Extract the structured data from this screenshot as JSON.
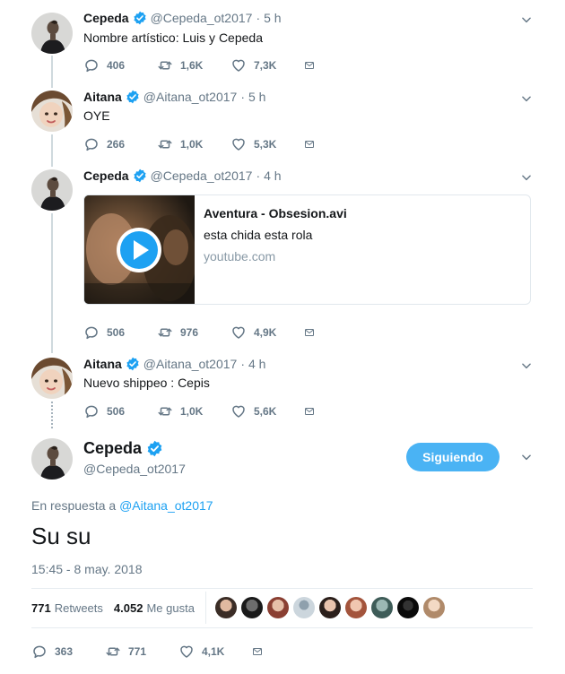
{
  "colors": {
    "accent": "#1da1f2",
    "muted": "#657786",
    "follow_bg": "#4ab3f4"
  },
  "tweets": [
    {
      "name": "Cepeda",
      "handle": "@Cepeda_ot2017",
      "time": "5 h",
      "text": "Nombre artístico: Luis y Cepeda",
      "replies": "406",
      "retweets": "1,6K",
      "likes": "7,3K"
    },
    {
      "name": "Aitana",
      "handle": "@Aitana_ot2017",
      "time": "5 h",
      "text": "OYE",
      "replies": "266",
      "retweets": "1,0K",
      "likes": "5,3K"
    },
    {
      "name": "Cepeda",
      "handle": "@Cepeda_ot2017",
      "time": "4 h",
      "card": {
        "title": "Aventura - Obsesion.avi",
        "description": "esta chida esta rola",
        "domain": "youtube.com"
      },
      "replies": "506",
      "retweets": "976",
      "likes": "4,9K"
    },
    {
      "name": "Aitana",
      "handle": "@Aitana_ot2017",
      "time": "4 h",
      "text": "Nuevo shippeo : Cepis",
      "replies": "506",
      "retweets": "1,0K",
      "likes": "5,6K"
    }
  ],
  "main_tweet": {
    "name": "Cepeda",
    "handle": "@Cepeda_ot2017",
    "follow_label": "Siguiendo",
    "reply_prefix": "En respuesta a",
    "reply_to": "@Aitana_ot2017",
    "text": "Su su",
    "timestamp": "15:45 - 8 may. 2018",
    "retweets_count": "771",
    "retweets_label": "Retweets",
    "likes_count": "4.052",
    "likes_label": "Me gusta",
    "replies": "363",
    "retweets": "771",
    "likes": "4,1K"
  }
}
